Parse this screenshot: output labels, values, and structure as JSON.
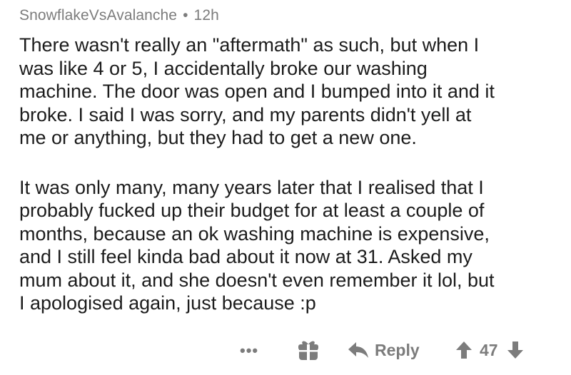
{
  "comment": {
    "author": "SnowflakeVsAvalanche",
    "separator": "•",
    "age": "12h",
    "paragraphs": [
      "There wasn't really an \"aftermath\" as such, but when I\nwas like 4 or 5, I accidentally broke our washing\nmachine. The door was open and I bumped into it and it\nbroke. I said I was sorry, and my parents didn't yell at\nme or anything, but they had to get a new one.",
      "It was only many, many years later that I realised that I\nprobably fucked up their budget for at least a couple of\nmonths, because an ok washing machine is expensive,\nand I still feel kinda bad about it now at 31. Asked my\nmum about it, and she doesn't even remember it lol, but\nI apologised again, just because :p"
    ]
  },
  "actions": {
    "more_label": "•••",
    "award_icon": "gift-icon",
    "reply_icon": "reply-arrow-icon",
    "reply_label": "Reply",
    "upvote_icon": "upvote-arrow-icon",
    "score": "47",
    "downvote_icon": "downvote-arrow-icon"
  },
  "colors": {
    "text": "#1c1c1c",
    "meta": "#7c7c7c",
    "background": "#ffffff"
  }
}
